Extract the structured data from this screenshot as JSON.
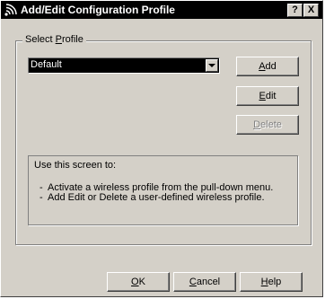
{
  "window": {
    "title": "Add/Edit Configuration Profile",
    "help_button": "?",
    "close_button": "X",
    "icon": "wireless-signal-icon"
  },
  "profile_group": {
    "label_prefix": "Select ",
    "label_accel": "P",
    "label_suffix": "rofile",
    "selected_profile": "Default",
    "dropdown_icon": "chevron-down-icon"
  },
  "actions": {
    "add": {
      "accel": "A",
      "rest": "dd",
      "enabled": true
    },
    "edit": {
      "accel": "E",
      "rest": "dit",
      "enabled": true
    },
    "delete": {
      "accel": "D",
      "rest": "elete",
      "enabled": false
    }
  },
  "info": {
    "heading": "Use this screen to:",
    "items": [
      "Activate a wireless profile from the pull-down menu.",
      "Add Edit or Delete a user-defined wireless profile."
    ],
    "bullet": "-"
  },
  "footer": {
    "ok": {
      "accel": "O",
      "rest": "K"
    },
    "cancel": {
      "accel": "C",
      "rest": "ancel"
    },
    "help": {
      "accel": "H",
      "rest": "elp"
    }
  },
  "colors": {
    "dialog_bg": "#d4d0c8",
    "titlebar_bg": "#000000",
    "selection_bg": "#000000",
    "disabled_text": "#808080"
  }
}
